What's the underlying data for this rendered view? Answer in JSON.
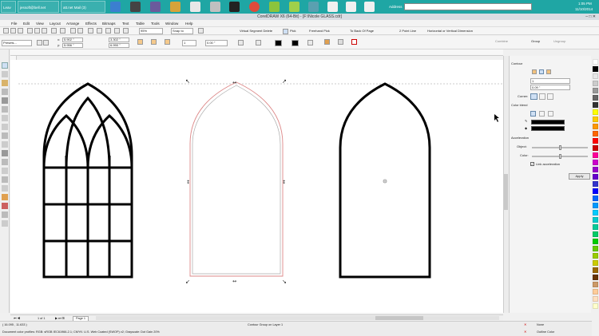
{
  "taskbar": {
    "start_label": "Leav",
    "email_label": "jessoft@bell.net",
    "mail_app_label": "att.net Mail (3)",
    "address_label": "Address",
    "clock_time": "1:05 PM",
    "clock_date": "11/10/2014"
  },
  "window": {
    "title": "CorelDRAW X6 (64-Bit) - [F:\\Nicole GLASS.cdr]",
    "controls": "–  □  ✕"
  },
  "menu": [
    "File",
    "Edit",
    "View",
    "Layout",
    "Arrange",
    "Effects",
    "Bitmaps",
    "Text",
    "Table",
    "Tools",
    "Window",
    "Help"
  ],
  "standard_toolbar": {
    "zoom_value": "95%",
    "snap_label": "Snap to"
  },
  "node_toolbar": {
    "virtual_segment_delete": "Virtual Segment Delete",
    "pick_label": "Pick",
    "freehand_pick": "Freehand Pick",
    "to_back_of_page": "To Back Of Page",
    "two_point_line": "2 Point Line",
    "horiz_vert_dimension": "Horizontal or Vertical Dimension",
    "combine": "Combine",
    "group": "Group",
    "ungroup": "Ungroup"
  },
  "property_bar": {
    "preset_label": "Presets...",
    "x_value": "5.902 \"",
    "y_value": "5.956 \"",
    "width_value": "3.302 \"",
    "height_value": "6.990 \"",
    "angle_value": "0.00 °",
    "steps_value": "1",
    "offset_value": "0.00 \""
  },
  "docker": {
    "title": "Contour",
    "steps_value": "1",
    "offset_value": "0.09 \"",
    "corner_label": "Corner:",
    "color_blend_label": "Color blend",
    "acceleration_label": "Acceleration",
    "object_label": "Object:",
    "color_label": "Color:",
    "link_acceleration": "Link acceleration",
    "apply_label": "Apply",
    "object_accel": 0.5,
    "color_accel": 0.5,
    "outline_color": "#000000",
    "fill_color": "#000000"
  },
  "palette": [
    "#ffffff",
    "#000000",
    "#e6e6e6",
    "#cccccc",
    "#999999",
    "#666666",
    "#333333",
    "#ffff00",
    "#ffcc00",
    "#ff9900",
    "#ff6600",
    "#ff0000",
    "#cc0000",
    "#ff0099",
    "#cc00cc",
    "#9900cc",
    "#6600cc",
    "#3333cc",
    "#0000ff",
    "#0066ff",
    "#0099ff",
    "#00ccff",
    "#00cccc",
    "#00cc99",
    "#00cc66",
    "#00cc00",
    "#66cc00",
    "#99cc00",
    "#cccc00",
    "#996600",
    "#663300",
    "#cc9966",
    "#ffcc99",
    "#ffe0c0",
    "#ffffcc"
  ],
  "page_nav": {
    "page_counter": "1 of 1",
    "page_tab": "Page 1"
  },
  "status": {
    "coords": "( 16.095 , 11.633 )",
    "selection_info": "Contour Group on Layer 1",
    "color_profile": "Document color profiles: RGB: sRGB IEC61966-2.1; CMYK: U.S. Web Coated (SWOP) v2; Grayscale: Dot Gain 20%",
    "fill_label": "None",
    "outline_label": "Outline Color"
  }
}
